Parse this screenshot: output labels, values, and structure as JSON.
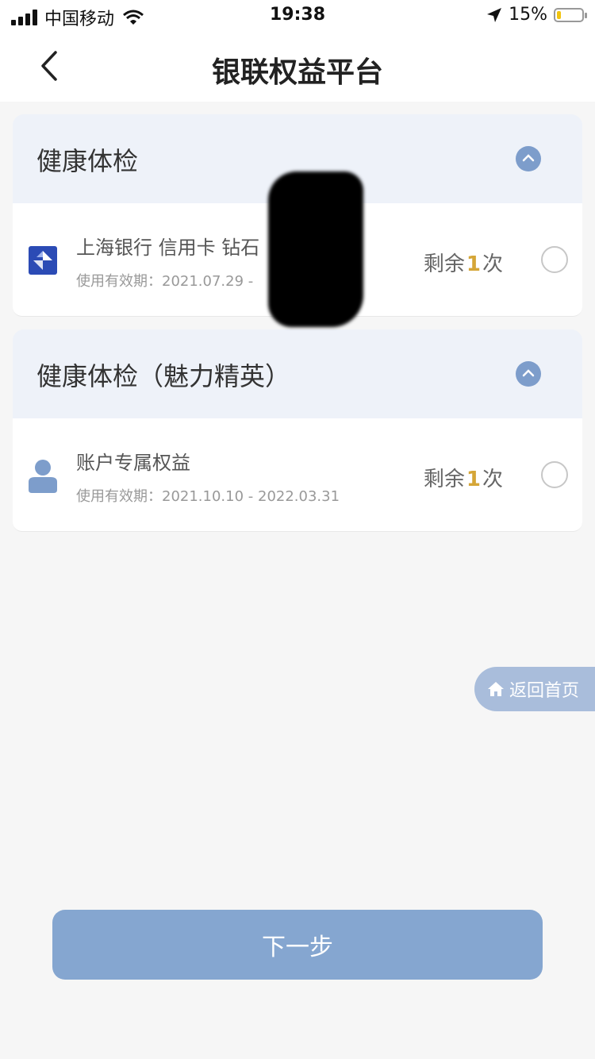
{
  "status_bar": {
    "carrier": "中国移动",
    "time": "19:38",
    "battery_percent": "15%",
    "battery_level": 0.15
  },
  "nav": {
    "title": "银联权益平台",
    "back_icon": "chevron-left-icon"
  },
  "sections": [
    {
      "title": "健康体检",
      "items": [
        {
          "icon": "bank-logo-icon",
          "name": "上海银行 信用卡 钻石",
          "validity": "使用有效期：2021.07.29 -",
          "remain_prefix": "剩余",
          "remain_count": "1",
          "remain_suffix": "次"
        }
      ]
    },
    {
      "title": "健康体检（魅力精英）",
      "items": [
        {
          "icon": "user-icon",
          "name": "账户专属权益",
          "validity": "使用有效期：2021.10.10 - 2022.03.31",
          "remain_prefix": "剩余",
          "remain_count": "1",
          "remain_suffix": "次"
        }
      ]
    }
  ],
  "home_button": {
    "label": "返回首页",
    "icon": "home-icon"
  },
  "next_button": {
    "label": "下一步"
  },
  "colors": {
    "accent": "#85a6d0",
    "section_bg": "#eef2f9",
    "count": "#d5a637"
  }
}
